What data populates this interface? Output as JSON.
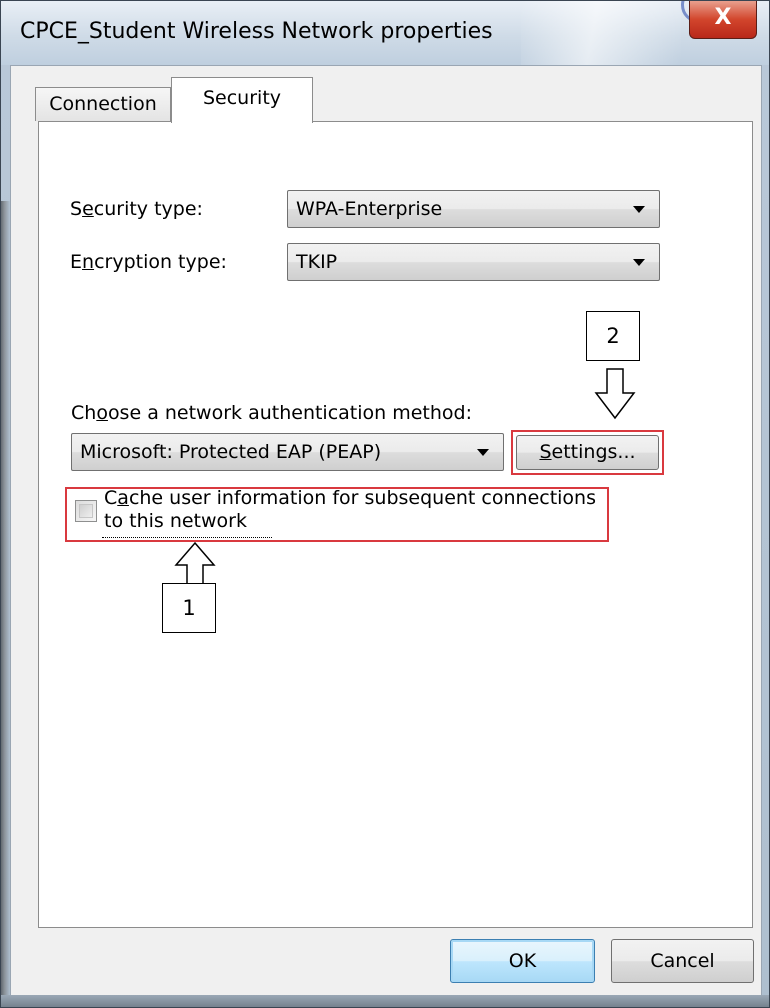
{
  "window": {
    "title": "CPCE_Student Wireless Network properties",
    "close_glyph": "X"
  },
  "tabs": [
    {
      "label": "Connection",
      "selected": false
    },
    {
      "label": "Security",
      "selected": true
    }
  ],
  "security_type": {
    "label_pre": "S",
    "label_ul": "e",
    "label_post": "curity type:",
    "value": "WPA-Enterprise"
  },
  "encryption_type": {
    "label_pre": "E",
    "label_ul": "n",
    "label_post": "cryption type:",
    "value": "TKIP"
  },
  "auth_method": {
    "label_pre": "Ch",
    "label_ul": "o",
    "label_post": "ose a network authentication method:",
    "value": "Microsoft: Protected EAP (PEAP)"
  },
  "settings_button": {
    "ul": "S",
    "rest": "ettings..."
  },
  "cache_checkbox": {
    "checked": false,
    "line1_pre": "C",
    "line1_ul": "a",
    "line1_post": "che user information for subsequent connections",
    "line2": "to this network"
  },
  "annotations": {
    "callout_1": "1",
    "callout_2": "2",
    "highlight_color": "#d9393f"
  },
  "buttons": {
    "ok": "OK",
    "cancel": "Cancel"
  },
  "icons": {
    "close": "close-icon",
    "dropdown": "chevron-down-icon",
    "annotation_arrow_up": "arrow-up-icon",
    "annotation_arrow_down": "arrow-down-icon"
  }
}
